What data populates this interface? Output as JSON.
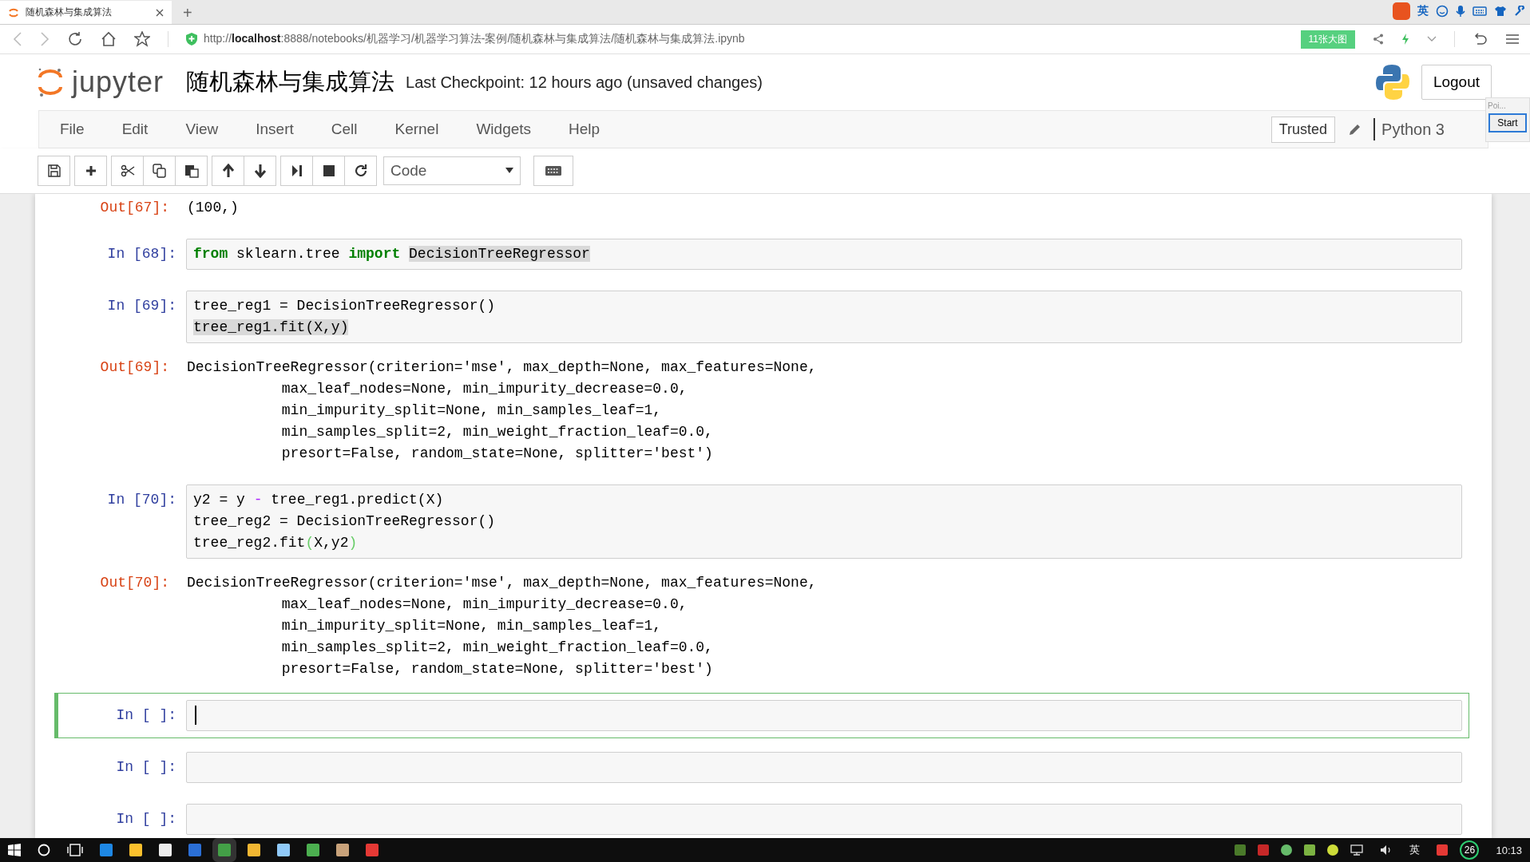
{
  "browser": {
    "tab_title": "随机森林与集成算法",
    "new_tab": "+",
    "address": "http://**localhost**:8888/notebooks/机器学习/机器学习算法-案例/随机森林与集成算法/随机森林与集成算法.ipynb",
    "extension_badge": "11张大图",
    "ime_mode": "英"
  },
  "jupyter": {
    "logo_text": "jupyter",
    "notebook_title": "随机森林与集成算法",
    "checkpoint": "Last Checkpoint: 12 hours ago (unsaved changes)",
    "logout": "Logout",
    "menu": [
      "File",
      "Edit",
      "View",
      "Insert",
      "Cell",
      "Kernel",
      "Widgets",
      "Help"
    ],
    "trusted": "Trusted",
    "kernel": "Python 3",
    "cell_type": "Code"
  },
  "popup": {
    "title": "Poi...",
    "button": "Start"
  },
  "cells": [
    {
      "kind": "output",
      "prompt": "Out[67]:",
      "lines": [
        "(100,)"
      ]
    },
    {
      "kind": "code",
      "prompt": "In [68]:",
      "selected": false,
      "lines": [
        [
          {
            "t": "from",
            "kind": "keyword"
          },
          {
            "t": " sklearn.tree ",
            "kind": "plain"
          },
          {
            "t": "import",
            "kind": "keyword"
          },
          {
            "t": "DecisionTreeRegressor",
            "kind": "highlight"
          }
        ]
      ]
    },
    {
      "kind": "code",
      "prompt": "In [69]:",
      "selected": false,
      "lines": [
        [
          {
            "t": "tree_reg1 = DecisionTreeRegressor()",
            "kind": "plain"
          }
        ],
        [
          {
            "t": "tree_reg1.fit(X,y)",
            "kind": "highlight"
          }
        ]
      ]
    },
    {
      "kind": "output",
      "prompt": "Out[69]:",
      "lines": [
        "DecisionTreeRegressor(criterion='mse', max_depth=None, max_features=None,",
        "           max_leaf_nodes=None, min_impurity_decrease=0.0,",
        "           min_impurity_split=None, min_samples_leaf=1,",
        "           min_samples_split=2, min_weight_fraction_leaf=0.0,",
        "           presort=False, random_state=None, splitter='best')"
      ]
    },
    {
      "kind": "code",
      "prompt": "In [70]:",
      "selected": false,
      "lines": [
        [
          {
            "t": "y2 = y ",
            "kind": "plain"
          },
          {
            "t": "-",
            "kind": "operator"
          },
          {
            "t": " tree_reg1.predict(X)",
            "kind": "plain"
          }
        ],
        [
          {
            "t": "tree_reg2 = DecisionTreeRegressor()",
            "kind": "plain"
          }
        ],
        [
          {
            "t": "tree_reg2.fit",
            "kind": "plain"
          },
          {
            "t": "(",
            "kind": "bracket"
          },
          {
            "t": "X,y2",
            "kind": "plain"
          },
          {
            "t": ")",
            "kind": "bracket"
          }
        ]
      ]
    },
    {
      "kind": "output",
      "prompt": "Out[70]:",
      "lines": [
        "DecisionTreeRegressor(criterion='mse', max_depth=None, max_features=None,",
        "           max_leaf_nodes=None, min_impurity_decrease=0.0,",
        "           min_impurity_split=None, min_samples_leaf=1,",
        "           min_samples_split=2, min_weight_fraction_leaf=0.0,",
        "           presort=False, random_state=None, splitter='best')"
      ]
    },
    {
      "kind": "code",
      "prompt": "In [ ]:",
      "selected": true
    },
    {
      "kind": "code",
      "prompt": "In [ ]:",
      "selected": false
    },
    {
      "kind": "code",
      "prompt": "In [ ]:",
      "selected": false
    }
  ],
  "taskbar": {
    "notification_count": "26",
    "ime_mode": "英",
    "clock": "10:13"
  }
}
